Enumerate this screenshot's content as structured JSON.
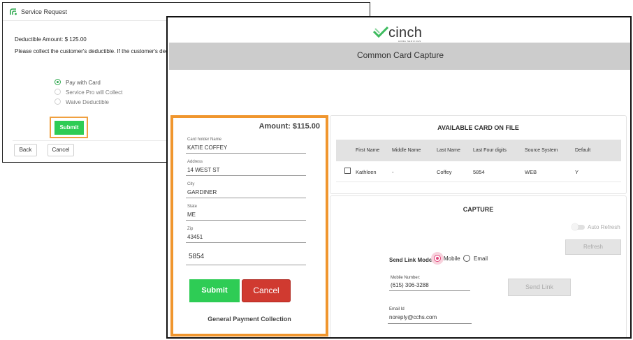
{
  "service_request": {
    "title": "Service Request",
    "deductible_amount": "Deductible Amount: $ 125.00",
    "instruction": "Please collect the customer's deductible. If the customer's dedu",
    "options": [
      {
        "label": "Pay with Card",
        "selected": true
      },
      {
        "label": "Service Pro will Collect",
        "selected": false
      },
      {
        "label": "Waive Deductible",
        "selected": false
      }
    ],
    "submit_label": "Submit",
    "back_label": "Back",
    "cancel_label": "Cancel"
  },
  "cinch": {
    "brand_name": "cinch",
    "brand_sub": "HOME SERVICES",
    "header_title": "Common Card Capture",
    "payment": {
      "amount": "Amount: $115.00",
      "fields": [
        {
          "label": "Card holder Name",
          "value": "KATIE COFFEY"
        },
        {
          "label": "Address",
          "value": "14 WEST ST"
        },
        {
          "label": "City",
          "value": "GARDINER"
        },
        {
          "label": "State",
          "value": "ME"
        },
        {
          "label": "Zip",
          "value": "43451"
        }
      ],
      "last_four": "5854",
      "submit_label": "Submit",
      "cancel_label": "Cancel",
      "footer": "General Payment Collection"
    },
    "cards_on_file": {
      "title": "AVAILABLE CARD ON FILE",
      "columns": [
        "First Name",
        "Middle Name",
        "Last Name",
        "Last Four digits",
        "Source System",
        "Default"
      ],
      "rows": [
        [
          "Kathleen",
          "-",
          "Coffey",
          "5854",
          "WEB",
          "Y"
        ]
      ]
    },
    "capture": {
      "title": "CAPTURE",
      "auto_refresh_label": "Auto Refresh",
      "refresh_label": "Refresh",
      "send_link_mode_label": "Send Link Mode:",
      "mode_options": [
        "Mobile",
        "Email"
      ],
      "selected_mode": "Mobile",
      "mobile_label": "Mobile Number:",
      "mobile_value": "(615) 306-3288",
      "send_link_label": "Send Link",
      "email_label": "Email Id",
      "email_value": "noreply@cchs.com"
    }
  },
  "colors": {
    "accent_green": "#2ecc55",
    "highlight_orange": "#f0962e",
    "cancel_red": "#d03a30",
    "radio_pink": "#e0447a",
    "header_gray": "#cccccc"
  }
}
